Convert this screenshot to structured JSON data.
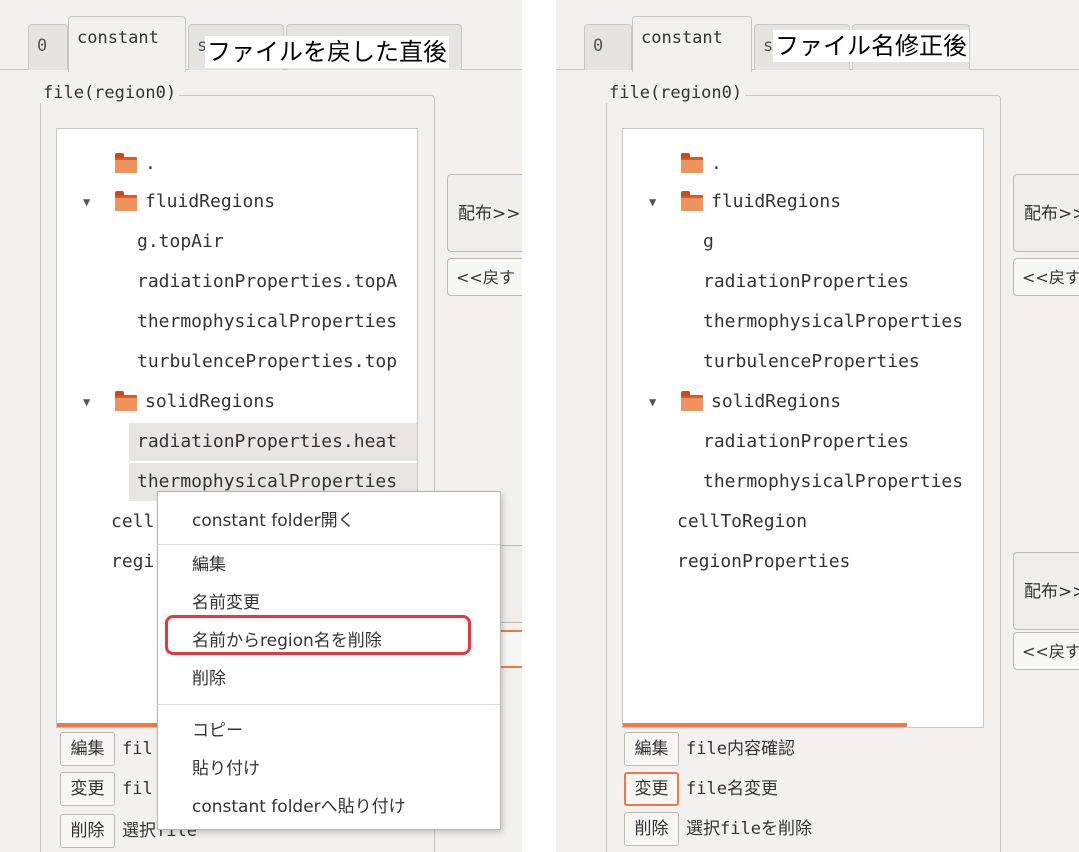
{
  "annotations": {
    "left": "ファイルを戻した直後",
    "right": "ファイル名修正後"
  },
  "tabs": {
    "t0": "0",
    "constant": "constant",
    "partial": "s"
  },
  "group_label": "file(region0)",
  "left_tree": {
    "dot": ".",
    "fluid_folder": "fluidRegions",
    "fluid_files": [
      "g.topAir",
      "radiationProperties.topA",
      "thermophysicalProperties",
      "turbulenceProperties.top"
    ],
    "solid_folder": "solidRegions",
    "solid_files": [
      "radiationProperties.heat",
      "thermophysicalProperties"
    ],
    "other_files": [
      "cellToRegion",
      "regionProperties"
    ],
    "other_files_visible": [
      "cell",
      "regi"
    ]
  },
  "right_tree": {
    "dot": ".",
    "fluid_folder": "fluidRegions",
    "fluid_files": [
      "g",
      "radiationProperties",
      "thermophysicalProperties",
      "turbulenceProperties"
    ],
    "solid_folder": "solidRegions",
    "solid_files": [
      "radiationProperties",
      "thermophysicalProperties"
    ],
    "other_files": [
      "cellToRegion",
      "regionProperties"
    ]
  },
  "side_buttons": {
    "distribute": "配布>>",
    "return": "<<戻す"
  },
  "bottom": {
    "edit_button": "編集",
    "edit_label": "file内容確認",
    "rename_button": "変更",
    "rename_label": "file名変更",
    "delete_button": "削除",
    "delete_label": "選択fileを削除",
    "left_edit_label": "fil",
    "left_rename_label": "fil",
    "left_delete_label": "選択file"
  },
  "context_menu": {
    "open_folder": "constant folder開く",
    "edit": "編集",
    "rename": "名前変更",
    "remove_region": "名前からregion名を削除",
    "delete": "削除",
    "copy": "コピー",
    "paste": "貼り付け",
    "paste_to_folder": "constant folderへ貼り付け"
  },
  "colors": {
    "accent": "#f07746",
    "highlight": "#e8383d",
    "folder": "#e6571b"
  }
}
